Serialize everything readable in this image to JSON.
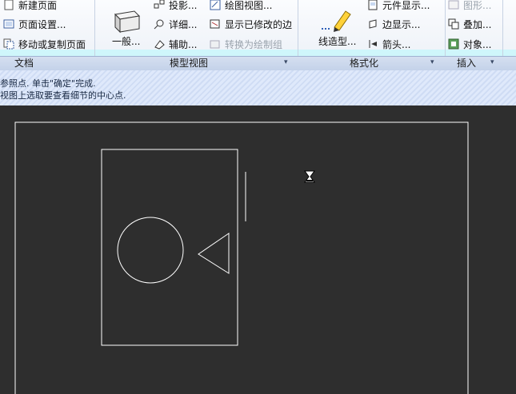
{
  "ribbon": {
    "doc_group": {
      "label": "文档",
      "items": [
        "新建页面",
        "页面设置...",
        "移动或复制页面"
      ]
    },
    "model_view_group": {
      "label": "模型视图",
      "big_button": "一般...",
      "items": [
        "投影...",
        "详细...",
        "辅助...",
        "绘图视图...",
        "显示已修改的边",
        "转换为绘制组"
      ]
    },
    "format_group": {
      "label": "格式化",
      "big_button": "线造型...",
      "items": [
        "元件显示...",
        "边显示...",
        "箭头..."
      ]
    },
    "insert_group": {
      "label": "插入",
      "items": [
        "图形...",
        "叠加...",
        "对象..."
      ]
    }
  },
  "message": {
    "line1": "参照点. 单击\"确定\"完成.",
    "line2": "视图上选取要查看细节的中心点."
  },
  "canvas": {
    "cursor": "hourglass-icon"
  },
  "colors": {
    "canvas_bg": "#2e2e2e",
    "drawing_line": "#ffffff",
    "message_bg": "#dfe9fb"
  }
}
